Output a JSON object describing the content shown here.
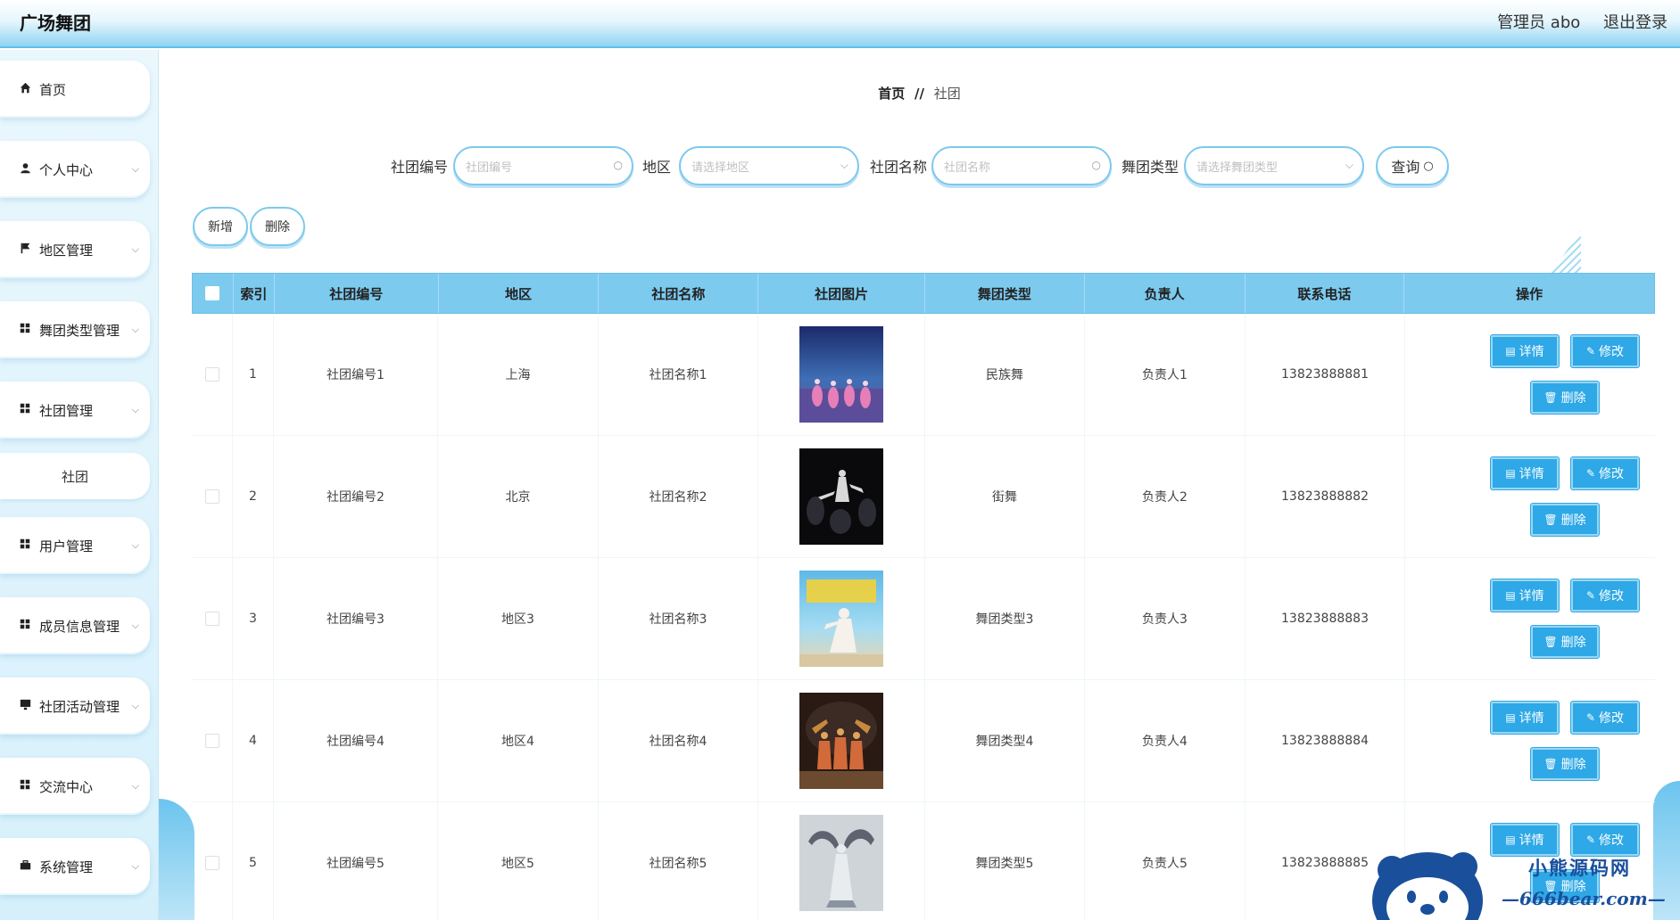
{
  "header": {
    "title": "广场舞团",
    "user": "管理员 abo",
    "logout": "退出登录"
  },
  "sidebar": {
    "items": [
      {
        "label": "首页",
        "icon": "home-icon"
      },
      {
        "label": "个人中心",
        "icon": "user-icon"
      },
      {
        "label": "地区管理",
        "icon": "flag-icon"
      },
      {
        "label": "舞团类型管理",
        "icon": "grid-icon"
      },
      {
        "label": "社团管理",
        "icon": "grid-icon"
      },
      {
        "label": "用户管理",
        "icon": "grid-icon"
      },
      {
        "label": "成员信息管理",
        "icon": "grid-icon"
      },
      {
        "label": "社团活动管理",
        "icon": "monitor-icon"
      },
      {
        "label": "交流中心",
        "icon": "grid-icon"
      },
      {
        "label": "系统管理",
        "icon": "briefcase-icon"
      }
    ],
    "subitem": "社团"
  },
  "breadcrumb": {
    "home": "首页",
    "sep": "//",
    "current": "社团"
  },
  "search": {
    "code_label": "社团编号",
    "code_placeholder": "社团编号",
    "area_label": "地区",
    "area_placeholder": "请选择地区",
    "name_label": "社团名称",
    "name_placeholder": "社团名称",
    "type_label": "舞团类型",
    "type_placeholder": "请选择舞团类型",
    "query_label": "查询"
  },
  "actions": {
    "add": "新增",
    "delete": "删除"
  },
  "table": {
    "columns": [
      "索引",
      "社团编号",
      "地区",
      "社团名称",
      "社团图片",
      "舞团类型",
      "负责人",
      "联系电话",
      "操作"
    ],
    "op_labels": {
      "detail": "详情",
      "edit": "修改",
      "delete": "删除"
    },
    "rows": [
      {
        "index": "1",
        "code": "社团编号1",
        "area": "上海",
        "name": "社团名称1",
        "type": "民族舞",
        "leader": "负责人1",
        "phone": "13823888881"
      },
      {
        "index": "2",
        "code": "社团编号2",
        "area": "北京",
        "name": "社团名称2",
        "type": "街舞",
        "leader": "负责人2",
        "phone": "13823888882"
      },
      {
        "index": "3",
        "code": "社团编号3",
        "area": "地区3",
        "name": "社团名称3",
        "type": "舞团类型3",
        "leader": "负责人3",
        "phone": "13823888883"
      },
      {
        "index": "4",
        "code": "社团编号4",
        "area": "地区4",
        "name": "社团名称4",
        "type": "舞团类型4",
        "leader": "负责人4",
        "phone": "13823888884"
      },
      {
        "index": "5",
        "code": "社团编号5",
        "area": "地区5",
        "name": "社团名称5",
        "type": "舞团类型5",
        "leader": "负责人5",
        "phone": "13823888885"
      }
    ]
  },
  "watermark": {
    "line1": "小熊源码网",
    "line2": "—666bear.com—"
  },
  "colors": {
    "accent": "#2ea8e6",
    "header_blue": "#7dcaef",
    "border_blue": "#7cc9ee"
  }
}
